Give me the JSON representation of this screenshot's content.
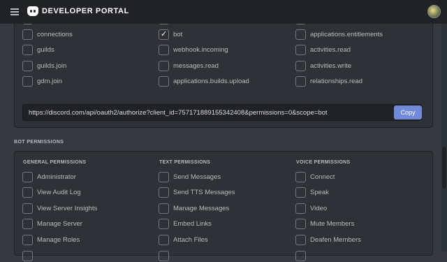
{
  "header": {
    "brand": "DEVELOPER PORTAL",
    "menu_icon": "hamburger-icon",
    "avatar_icon": "user-avatar"
  },
  "scopes": [
    [
      "connections",
      "bot",
      "applications.entitlements"
    ],
    [
      "guilds",
      "webhook.incoming",
      "activities.read"
    ],
    [
      "guilds.join",
      "messages.read",
      "activities.write"
    ],
    [
      "gdm.join",
      "applications.builds.upload",
      "relationships.read"
    ]
  ],
  "checked_scope": "bot",
  "generated_url": "https://discord.com/api/oauth2/authorize?client_id=757171889155342408&permissions=0&scope=bot",
  "copy_label": "Copy",
  "bot_permissions": {
    "title": "BOT PERMISSIONS",
    "columns": [
      {
        "title": "GENERAL PERMISSIONS",
        "items": [
          "Administrator",
          "View Audit Log",
          "View Server Insights",
          "Manage Server",
          "Manage Roles"
        ]
      },
      {
        "title": "TEXT PERMISSIONS",
        "items": [
          "Send Messages",
          "Send TTS Messages",
          "Manage Messages",
          "Embed Links",
          "Attach Files"
        ]
      },
      {
        "title": "VOICE PERMISSIONS",
        "items": [
          "Connect",
          "Speak",
          "Video",
          "Mute Members",
          "Deafen Members"
        ]
      }
    ]
  },
  "colors": {
    "background": "#36393f",
    "panel": "#2f3136",
    "topbar": "#202225",
    "accent": "#7289da"
  }
}
